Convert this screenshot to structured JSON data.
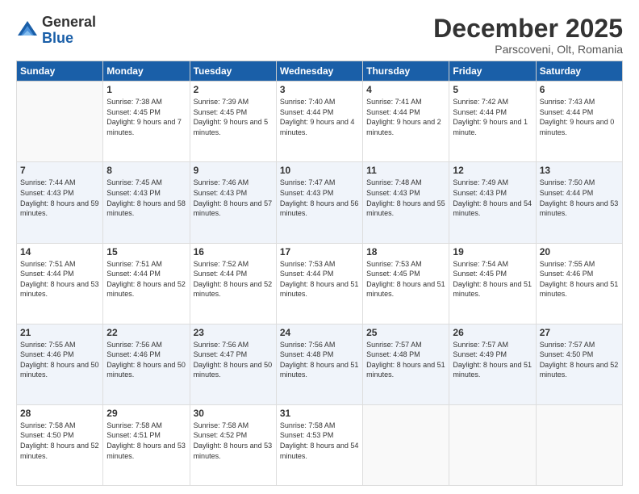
{
  "header": {
    "logo_line1": "General",
    "logo_line2": "Blue",
    "month": "December 2025",
    "location": "Parscoveni, Olt, Romania"
  },
  "days_of_week": [
    "Sunday",
    "Monday",
    "Tuesday",
    "Wednesday",
    "Thursday",
    "Friday",
    "Saturday"
  ],
  "weeks": [
    [
      {
        "day": "",
        "sunrise": "",
        "sunset": "",
        "daylight": ""
      },
      {
        "day": "1",
        "sunrise": "Sunrise: 7:38 AM",
        "sunset": "Sunset: 4:45 PM",
        "daylight": "Daylight: 9 hours and 7 minutes."
      },
      {
        "day": "2",
        "sunrise": "Sunrise: 7:39 AM",
        "sunset": "Sunset: 4:45 PM",
        "daylight": "Daylight: 9 hours and 5 minutes."
      },
      {
        "day": "3",
        "sunrise": "Sunrise: 7:40 AM",
        "sunset": "Sunset: 4:44 PM",
        "daylight": "Daylight: 9 hours and 4 minutes."
      },
      {
        "day": "4",
        "sunrise": "Sunrise: 7:41 AM",
        "sunset": "Sunset: 4:44 PM",
        "daylight": "Daylight: 9 hours and 2 minutes."
      },
      {
        "day": "5",
        "sunrise": "Sunrise: 7:42 AM",
        "sunset": "Sunset: 4:44 PM",
        "daylight": "Daylight: 9 hours and 1 minute."
      },
      {
        "day": "6",
        "sunrise": "Sunrise: 7:43 AM",
        "sunset": "Sunset: 4:44 PM",
        "daylight": "Daylight: 9 hours and 0 minutes."
      }
    ],
    [
      {
        "day": "7",
        "sunrise": "Sunrise: 7:44 AM",
        "sunset": "Sunset: 4:43 PM",
        "daylight": "Daylight: 8 hours and 59 minutes."
      },
      {
        "day": "8",
        "sunrise": "Sunrise: 7:45 AM",
        "sunset": "Sunset: 4:43 PM",
        "daylight": "Daylight: 8 hours and 58 minutes."
      },
      {
        "day": "9",
        "sunrise": "Sunrise: 7:46 AM",
        "sunset": "Sunset: 4:43 PM",
        "daylight": "Daylight: 8 hours and 57 minutes."
      },
      {
        "day": "10",
        "sunrise": "Sunrise: 7:47 AM",
        "sunset": "Sunset: 4:43 PM",
        "daylight": "Daylight: 8 hours and 56 minutes."
      },
      {
        "day": "11",
        "sunrise": "Sunrise: 7:48 AM",
        "sunset": "Sunset: 4:43 PM",
        "daylight": "Daylight: 8 hours and 55 minutes."
      },
      {
        "day": "12",
        "sunrise": "Sunrise: 7:49 AM",
        "sunset": "Sunset: 4:43 PM",
        "daylight": "Daylight: 8 hours and 54 minutes."
      },
      {
        "day": "13",
        "sunrise": "Sunrise: 7:50 AM",
        "sunset": "Sunset: 4:44 PM",
        "daylight": "Daylight: 8 hours and 53 minutes."
      }
    ],
    [
      {
        "day": "14",
        "sunrise": "Sunrise: 7:51 AM",
        "sunset": "Sunset: 4:44 PM",
        "daylight": "Daylight: 8 hours and 53 minutes."
      },
      {
        "day": "15",
        "sunrise": "Sunrise: 7:51 AM",
        "sunset": "Sunset: 4:44 PM",
        "daylight": "Daylight: 8 hours and 52 minutes."
      },
      {
        "day": "16",
        "sunrise": "Sunrise: 7:52 AM",
        "sunset": "Sunset: 4:44 PM",
        "daylight": "Daylight: 8 hours and 52 minutes."
      },
      {
        "day": "17",
        "sunrise": "Sunrise: 7:53 AM",
        "sunset": "Sunset: 4:44 PM",
        "daylight": "Daylight: 8 hours and 51 minutes."
      },
      {
        "day": "18",
        "sunrise": "Sunrise: 7:53 AM",
        "sunset": "Sunset: 4:45 PM",
        "daylight": "Daylight: 8 hours and 51 minutes."
      },
      {
        "day": "19",
        "sunrise": "Sunrise: 7:54 AM",
        "sunset": "Sunset: 4:45 PM",
        "daylight": "Daylight: 8 hours and 51 minutes."
      },
      {
        "day": "20",
        "sunrise": "Sunrise: 7:55 AM",
        "sunset": "Sunset: 4:46 PM",
        "daylight": "Daylight: 8 hours and 51 minutes."
      }
    ],
    [
      {
        "day": "21",
        "sunrise": "Sunrise: 7:55 AM",
        "sunset": "Sunset: 4:46 PM",
        "daylight": "Daylight: 8 hours and 50 minutes."
      },
      {
        "day": "22",
        "sunrise": "Sunrise: 7:56 AM",
        "sunset": "Sunset: 4:46 PM",
        "daylight": "Daylight: 8 hours and 50 minutes."
      },
      {
        "day": "23",
        "sunrise": "Sunrise: 7:56 AM",
        "sunset": "Sunset: 4:47 PM",
        "daylight": "Daylight: 8 hours and 50 minutes."
      },
      {
        "day": "24",
        "sunrise": "Sunrise: 7:56 AM",
        "sunset": "Sunset: 4:48 PM",
        "daylight": "Daylight: 8 hours and 51 minutes."
      },
      {
        "day": "25",
        "sunrise": "Sunrise: 7:57 AM",
        "sunset": "Sunset: 4:48 PM",
        "daylight": "Daylight: 8 hours and 51 minutes."
      },
      {
        "day": "26",
        "sunrise": "Sunrise: 7:57 AM",
        "sunset": "Sunset: 4:49 PM",
        "daylight": "Daylight: 8 hours and 51 minutes."
      },
      {
        "day": "27",
        "sunrise": "Sunrise: 7:57 AM",
        "sunset": "Sunset: 4:50 PM",
        "daylight": "Daylight: 8 hours and 52 minutes."
      }
    ],
    [
      {
        "day": "28",
        "sunrise": "Sunrise: 7:58 AM",
        "sunset": "Sunset: 4:50 PM",
        "daylight": "Daylight: 8 hours and 52 minutes."
      },
      {
        "day": "29",
        "sunrise": "Sunrise: 7:58 AM",
        "sunset": "Sunset: 4:51 PM",
        "daylight": "Daylight: 8 hours and 53 minutes."
      },
      {
        "day": "30",
        "sunrise": "Sunrise: 7:58 AM",
        "sunset": "Sunset: 4:52 PM",
        "daylight": "Daylight: 8 hours and 53 minutes."
      },
      {
        "day": "31",
        "sunrise": "Sunrise: 7:58 AM",
        "sunset": "Sunset: 4:53 PM",
        "daylight": "Daylight: 8 hours and 54 minutes."
      },
      {
        "day": "",
        "sunrise": "",
        "sunset": "",
        "daylight": ""
      },
      {
        "day": "",
        "sunrise": "",
        "sunset": "",
        "daylight": ""
      },
      {
        "day": "",
        "sunrise": "",
        "sunset": "",
        "daylight": ""
      }
    ]
  ]
}
